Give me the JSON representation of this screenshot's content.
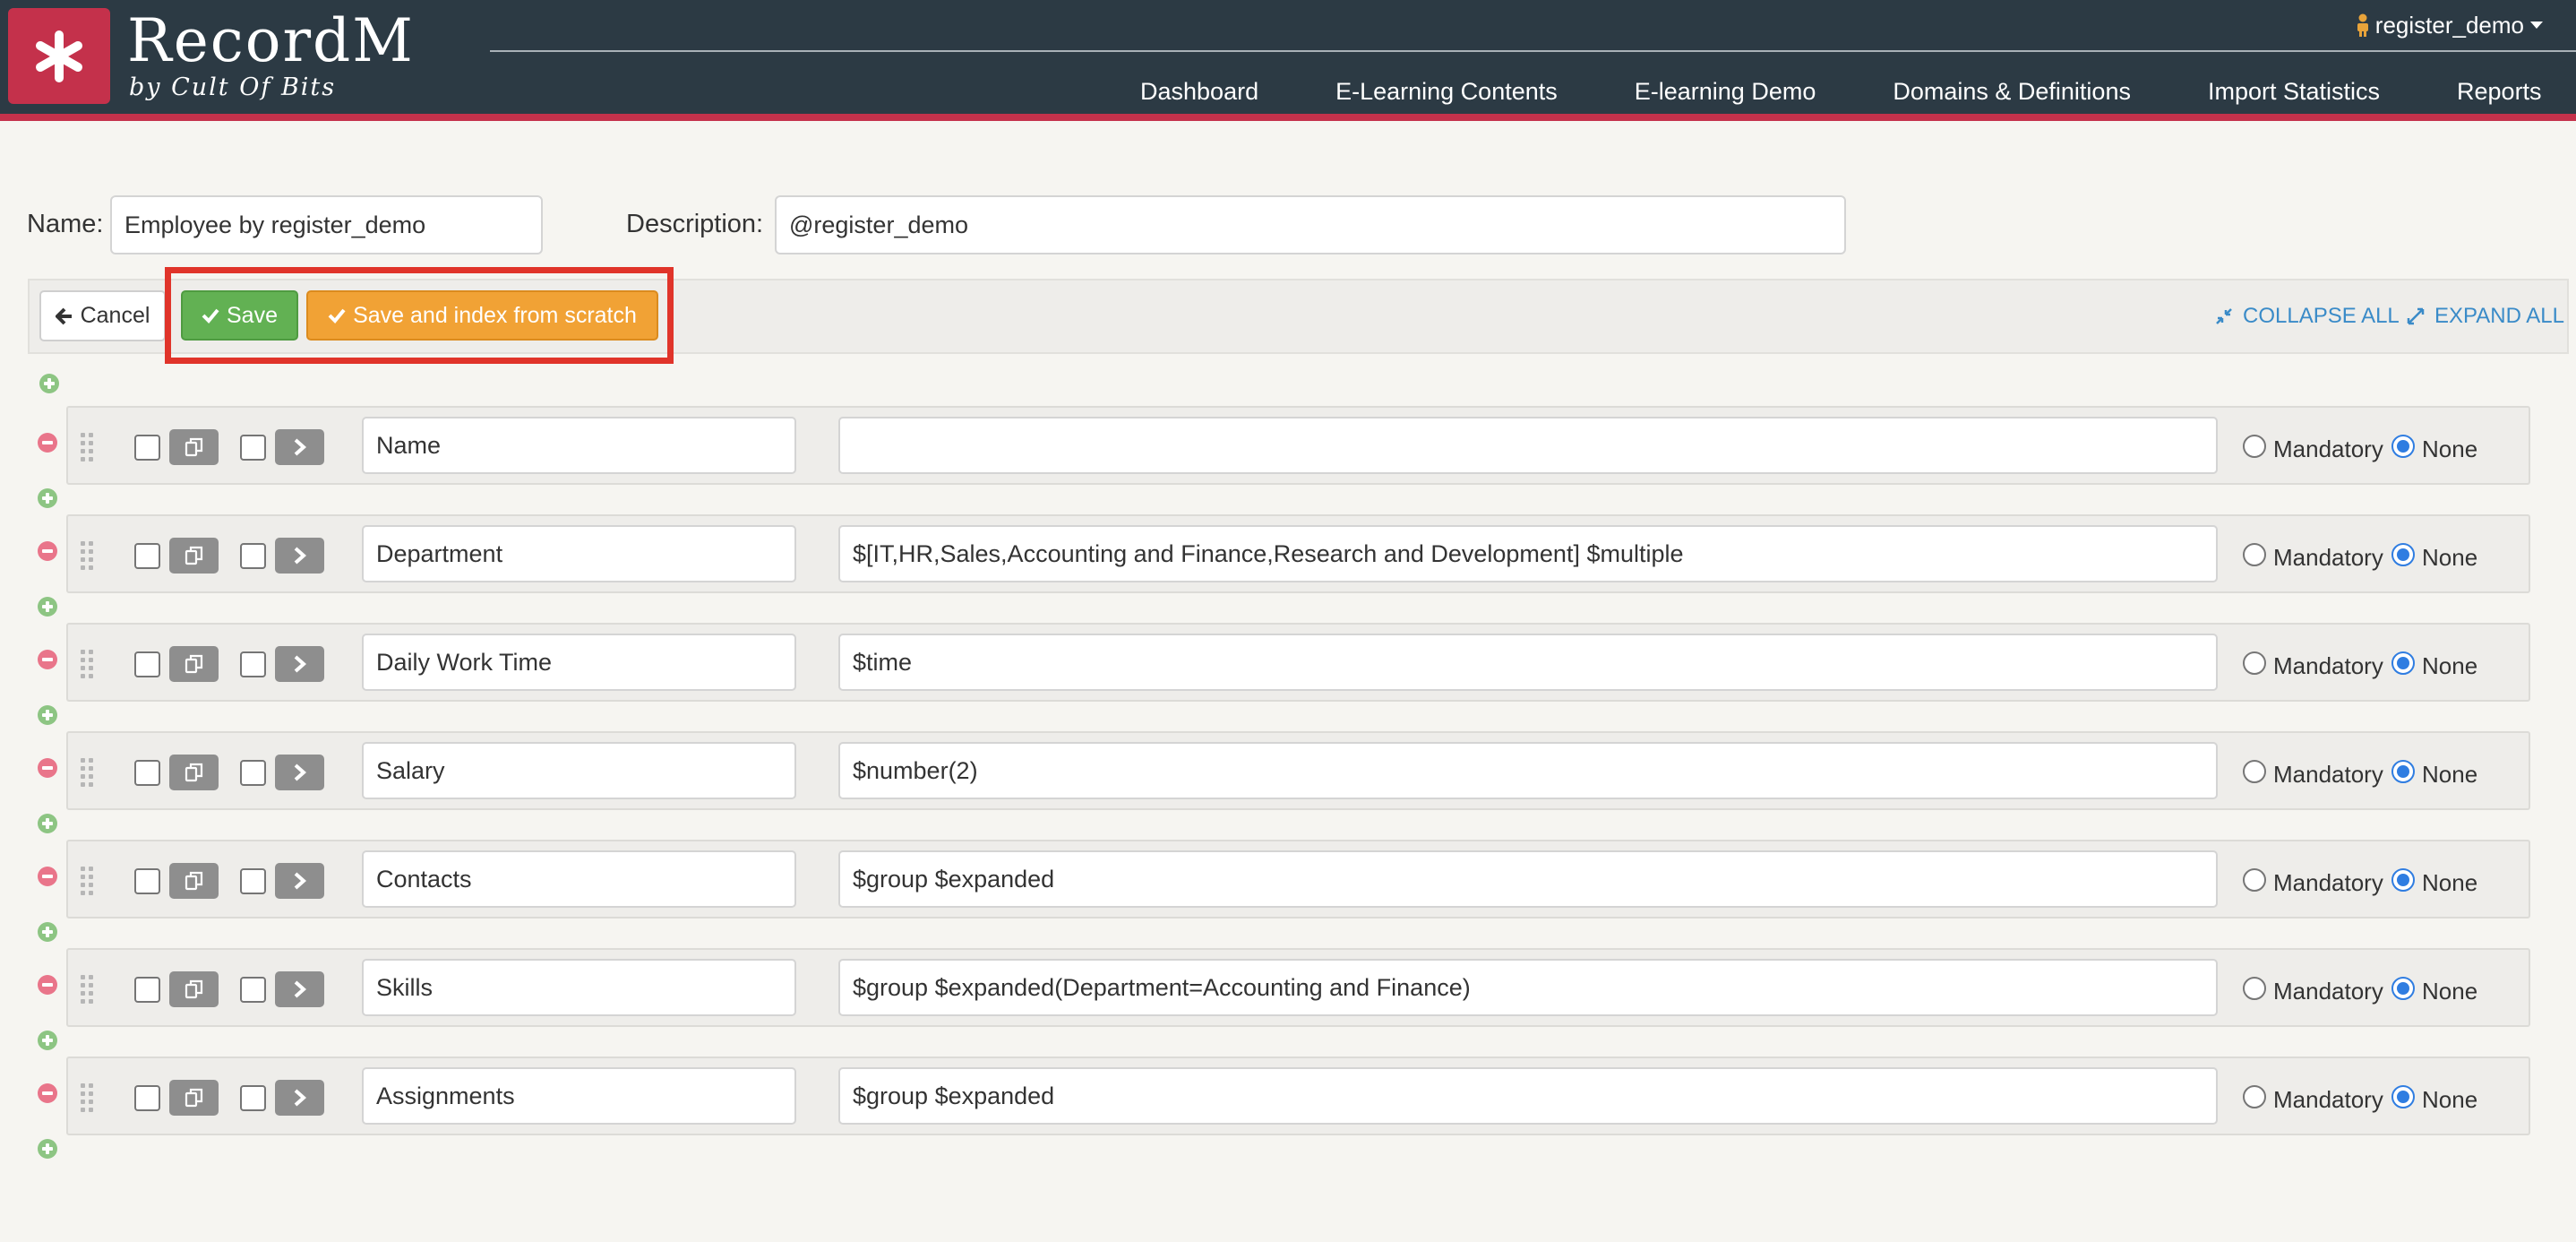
{
  "app": {
    "logo_title": "RecordM",
    "logo_subtitle": "by Cult Of Bits",
    "user": "register_demo"
  },
  "nav": [
    "Dashboard",
    "E-Learning Contents",
    "E-learning Demo",
    "Domains & Definitions",
    "Import Statistics",
    "Reports"
  ],
  "form": {
    "name_label": "Name:",
    "name_value": "Employee by register_demo",
    "description_label": "Description:",
    "description_value": "@register_demo"
  },
  "toolbar": {
    "cancel_label": "Cancel",
    "save_label": "Save",
    "save_index_label": "Save and index from scratch",
    "collapse_all_label": "COLLAPSE ALL",
    "expand_all_label": "EXPAND ALL"
  },
  "radio_labels": {
    "mandatory": "Mandatory",
    "none": "None"
  },
  "fields": [
    {
      "name": "Name",
      "description": "",
      "mandatory": false
    },
    {
      "name": "Department",
      "description": "$[IT,HR,Sales,Accounting and Finance,Research and Development] $multiple",
      "mandatory": false
    },
    {
      "name": "Daily Work Time",
      "description": "$time",
      "mandatory": false
    },
    {
      "name": "Salary",
      "description": "$number(2)",
      "mandatory": false
    },
    {
      "name": "Contacts",
      "description": "$group $expanded",
      "mandatory": false
    },
    {
      "name": "Skills",
      "description": "$group $expanded(Department=Accounting and Finance)",
      "mandatory": false
    },
    {
      "name": "Assignments",
      "description": "$group $expanded",
      "mandatory": false
    }
  ],
  "colors": {
    "header_bg": "#2c3a44",
    "brand_red": "#c4314b",
    "save_green": "#62b153",
    "index_orange": "#f1a235",
    "link_blue": "#3a8bc8",
    "highlight_red": "#e0342a"
  },
  "icons": {
    "logo": "asterisk-icon",
    "user": "user-icon",
    "cancel": "arrow-left-icon",
    "save": "check-icon",
    "collapse": "compress-icon",
    "expand": "expand-icon",
    "duplicate": "copy-icon",
    "details": "chevron-right-icon"
  }
}
